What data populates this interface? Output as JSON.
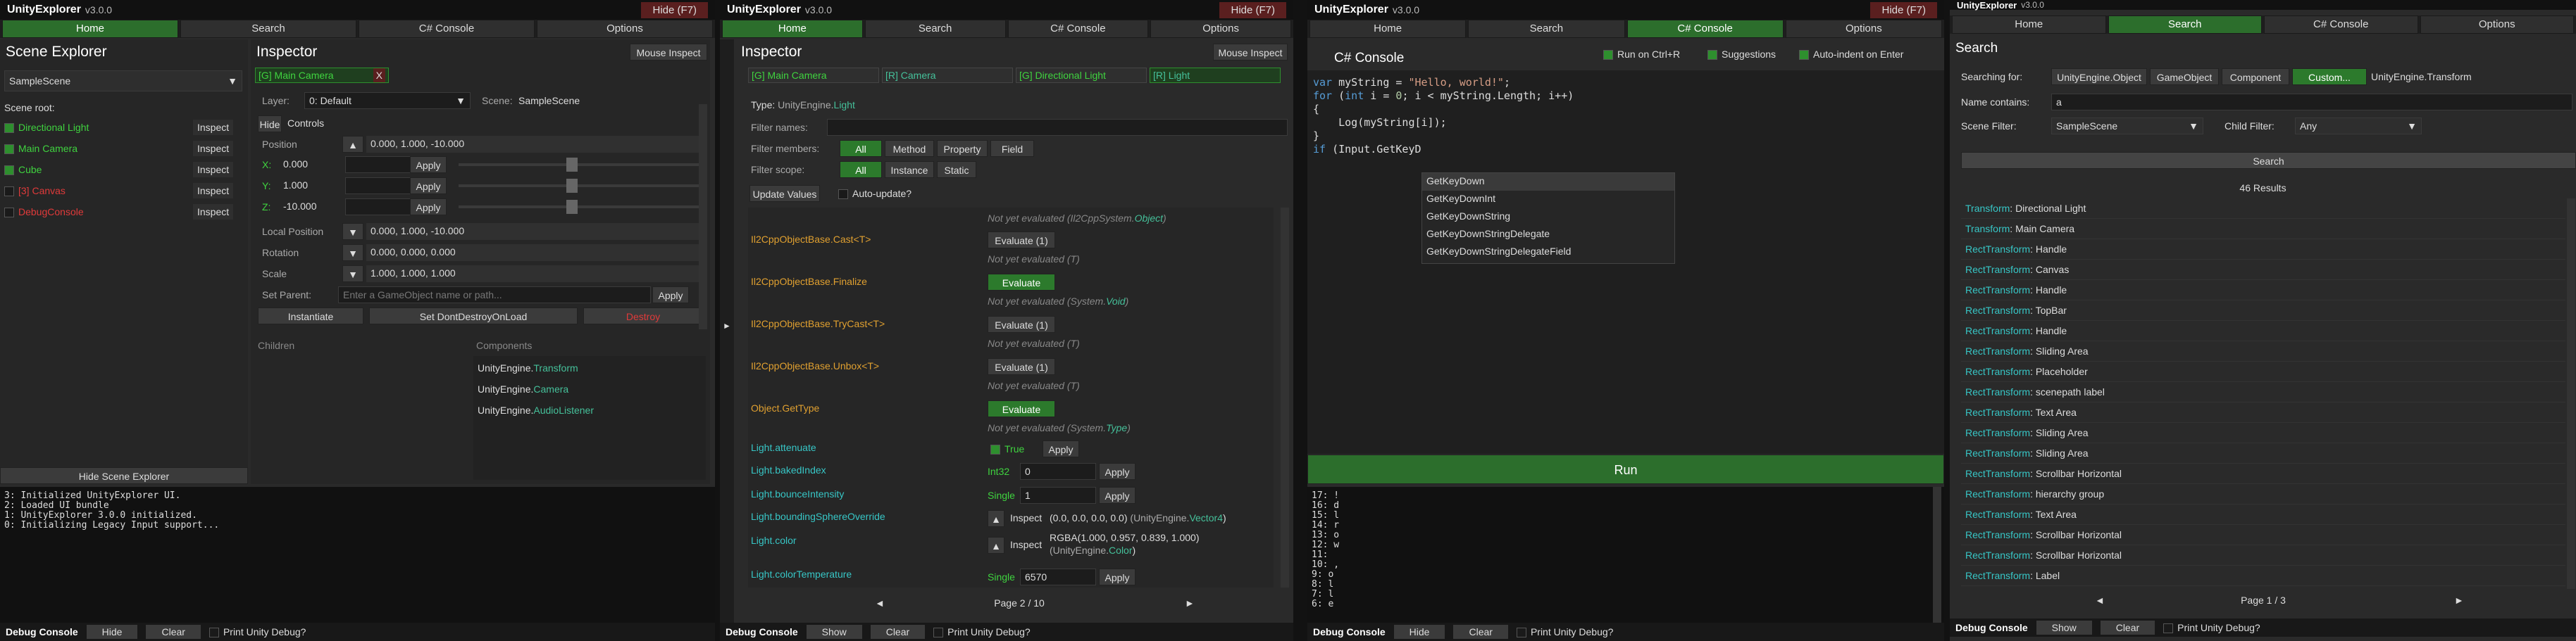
{
  "colors": {
    "accent_green": "#2c7a2c",
    "hide_red": "#5a1f1f",
    "type_teal": "#45c09a",
    "active_go": "#3fd33f",
    "inactive_go": "#e03a3a"
  },
  "app": {
    "title": "UnityExplorer",
    "version": "v3.0.0",
    "hide": "Hide (F7)"
  },
  "nav": [
    "Home",
    "Search",
    "C# Console",
    "Options"
  ],
  "p1": {
    "scene_explorer": "Scene Explorer",
    "scene_dropdown": "SampleScene",
    "scene_root": "Scene root:",
    "items": [
      {
        "name": "Directional Light",
        "inspect": "Inspect"
      },
      {
        "name": "Main Camera",
        "inspect": "Inspect"
      },
      {
        "name": "Cube",
        "inspect": "Inspect"
      },
      {
        "name": "[3] Canvas",
        "inspect": "Inspect"
      },
      {
        "name": "DebugConsole",
        "inspect": "Inspect"
      }
    ],
    "hide_scene_explorer": "Hide Scene Explorer",
    "inspector": "Inspector",
    "mouse_inspect": "Mouse Inspect",
    "tab": "[G] Main Camera",
    "tab_close": "X",
    "layer_label": "Layer:",
    "layer_value": "0: Default",
    "scene_label": "Scene:",
    "scene_value": "SampleScene",
    "hide": "Hide",
    "controls": "Controls",
    "position_label": "Position",
    "position_value": "0.000, 1.000, -10.000",
    "x_label": "X:",
    "x_value": "0.000",
    "y_label": "Y:",
    "y_value": "1.000",
    "z_label": "Z:",
    "z_value": "-10.000",
    "apply": "Apply",
    "local_position_label": "Local Position",
    "local_position_value": "0.000, 1.000, -10.000",
    "rotation_label": "Rotation",
    "rotation_value": "0.000, 0.000, 0.000",
    "scale_label": "Scale",
    "scale_value": "1.000, 1.000, 1.000",
    "set_parent_label": "Set Parent:",
    "set_parent_placeholder": "Enter a GameObject name or path...",
    "instantiate": "Instantiate",
    "dont_destroy": "Set DontDestroyOnLoad",
    "destroy": "Destroy",
    "children": "Children",
    "components": "Components",
    "comp": [
      [
        "UnityEngine.",
        "Transform"
      ],
      [
        "UnityEngine.",
        "Camera"
      ],
      [
        "UnityEngine.",
        "AudioListener"
      ]
    ],
    "log": [
      "3: Initialized UnityExplorer UI.",
      "2: Loaded UI bundle",
      "1: UnityExplorer 3.0.0 initialized.",
      "0: Initializing Legacy Input support..."
    ],
    "debug_console": "Debug Console",
    "hide_btn": "Hide",
    "clear": "Clear",
    "print_unity": "Print Unity Debug?"
  },
  "p2": {
    "inspector": "Inspector",
    "mouse_inspect": "Mouse Inspect",
    "tabs": [
      "[G] Main Camera",
      "[R] Camera",
      "[G] Directional Light",
      "[R] Light"
    ],
    "type_label": "Type:",
    "type_ns": "UnityEngine.",
    "type_name": "Light",
    "filter_names": "Filter names:",
    "filter_members": "Filter members:",
    "members": [
      "All",
      "Method",
      "Property",
      "Field"
    ],
    "filter_scope": "Filter scope:",
    "scopes": [
      "All",
      "Instance",
      "Static"
    ],
    "update_values": "Update Values",
    "auto_update": "Auto-update?",
    "not_eval_1": "Not yet evaluated",
    "not_eval_1_type_pre": "(Il2CppSystem.",
    "not_eval_1_type": "Object",
    "m_cast": "Il2CppObjectBase.Cast<T>",
    "m_cast_btn": "Evaluate (1)",
    "ne_t": "Not yet evaluated",
    "t_paren": "(T)",
    "m_finalize": "Il2CppObjectBase.Finalize",
    "evaluate": "Evaluate",
    "ne_void_pre": "(System.",
    "ne_void": "Void",
    "m_trycast": "Il2CppObjectBase.TryCast<T>",
    "m_unbox": "Il2CppObjectBase.Unbox<T>",
    "m_gettype": "Object.GetType",
    "ne_type": "Type",
    "attenuate": "Light.attenuate",
    "true_lbl": "True",
    "baked": "Light.bakedIndex",
    "int32": "Int32",
    "baked_v": "0",
    "bounce": "Light.bounceIntensity",
    "single": "Single",
    "bounce_v": "1",
    "bounding": "Light.boundingSphereOverride",
    "inspect": "Inspect",
    "bounding_v": "(0.0, 0.0, 0.0, 0.0)",
    "vec4_pre": "(UnityEngine.",
    "vec4": "Vector4",
    "color": "Light.color",
    "color_v": "RGBA(1.000, 0.957, 0.839, 1.000)",
    "color_type_pre": "(UnityEngine.",
    "color_type": "Color",
    "temp": "Light.colorTemperature",
    "temp_v": "6570",
    "page": "Page 2 / 10",
    "prev": "◄",
    "next": "►",
    "apply": "Apply",
    "debug_console": "Debug Console",
    "show": "Show",
    "clear": "Clear",
    "print_unity": "Print Unity Debug?"
  },
  "p3": {
    "title": "C# Console",
    "run_ctrl": "Run on Ctrl+R",
    "suggestions": "Suggestions",
    "auto_indent": "Auto-indent on Enter",
    "code": [
      "var myString = \"Hello, world!\";",
      "for (int i = 0; i < myString.Length; i++)",
      "{",
      "    Log(myString[i]);",
      "}",
      "",
      "if (Input.GetKeyD"
    ],
    "suggest": [
      "GetKeyDown",
      "GetKeyDownInt",
      "GetKeyDownString",
      "GetKeyDownStringDelegate",
      "GetKeyDownStringDelegateField"
    ],
    "run": "Run",
    "log": [
      "17: !",
      "16: d",
      "15: l",
      "14: r",
      "13: o",
      "12: w",
      "11:",
      "10: ,",
      "9: o",
      "8: l",
      "7: l",
      "6: e"
    ],
    "debug_console": "Debug Console",
    "hide_btn": "Hide",
    "clear": "Clear",
    "print_unity": "Print Unity Debug?"
  },
  "p4": {
    "title": "Search",
    "searching_for": "Searching for:",
    "types": [
      "UnityEngine.Object",
      "GameObject",
      "Component",
      "Custom..."
    ],
    "custom_value": "UnityEngine.Transform",
    "name_contains": "Name contains:",
    "name_value": "a",
    "scene_filter": "Scene Filter:",
    "scene_filter_value": "SampleScene",
    "child_filter": "Child Filter:",
    "child_filter_value": "Any",
    "search": "Search",
    "results_count": "46 Results",
    "results": [
      [
        "Transform",
        "Directional Light"
      ],
      [
        "Transform",
        "Main Camera"
      ],
      [
        "RectTransform",
        "Handle"
      ],
      [
        "RectTransform",
        "Canvas"
      ],
      [
        "RectTransform",
        "Handle"
      ],
      [
        "RectTransform",
        "TopBar"
      ],
      [
        "RectTransform",
        "Handle"
      ],
      [
        "RectTransform",
        "Sliding Area"
      ],
      [
        "RectTransform",
        "Placeholder"
      ],
      [
        "RectTransform",
        "scenepath label"
      ],
      [
        "RectTransform",
        "Text Area"
      ],
      [
        "RectTransform",
        "Sliding Area"
      ],
      [
        "RectTransform",
        "Sliding Area"
      ],
      [
        "RectTransform",
        "Scrollbar Horizontal"
      ],
      [
        "RectTransform",
        "hierarchy group"
      ],
      [
        "RectTransform",
        "Text Area"
      ],
      [
        "RectTransform",
        "Scrollbar Horizontal"
      ],
      [
        "RectTransform",
        "Scrollbar Horizontal"
      ],
      [
        "RectTransform",
        "Label"
      ]
    ],
    "page": "Page 1 / 3",
    "prev": "◄",
    "next": "►",
    "debug_console": "Debug Console",
    "show": "Show",
    "clear": "Clear",
    "print_unity": "Print Unity Debug?"
  }
}
